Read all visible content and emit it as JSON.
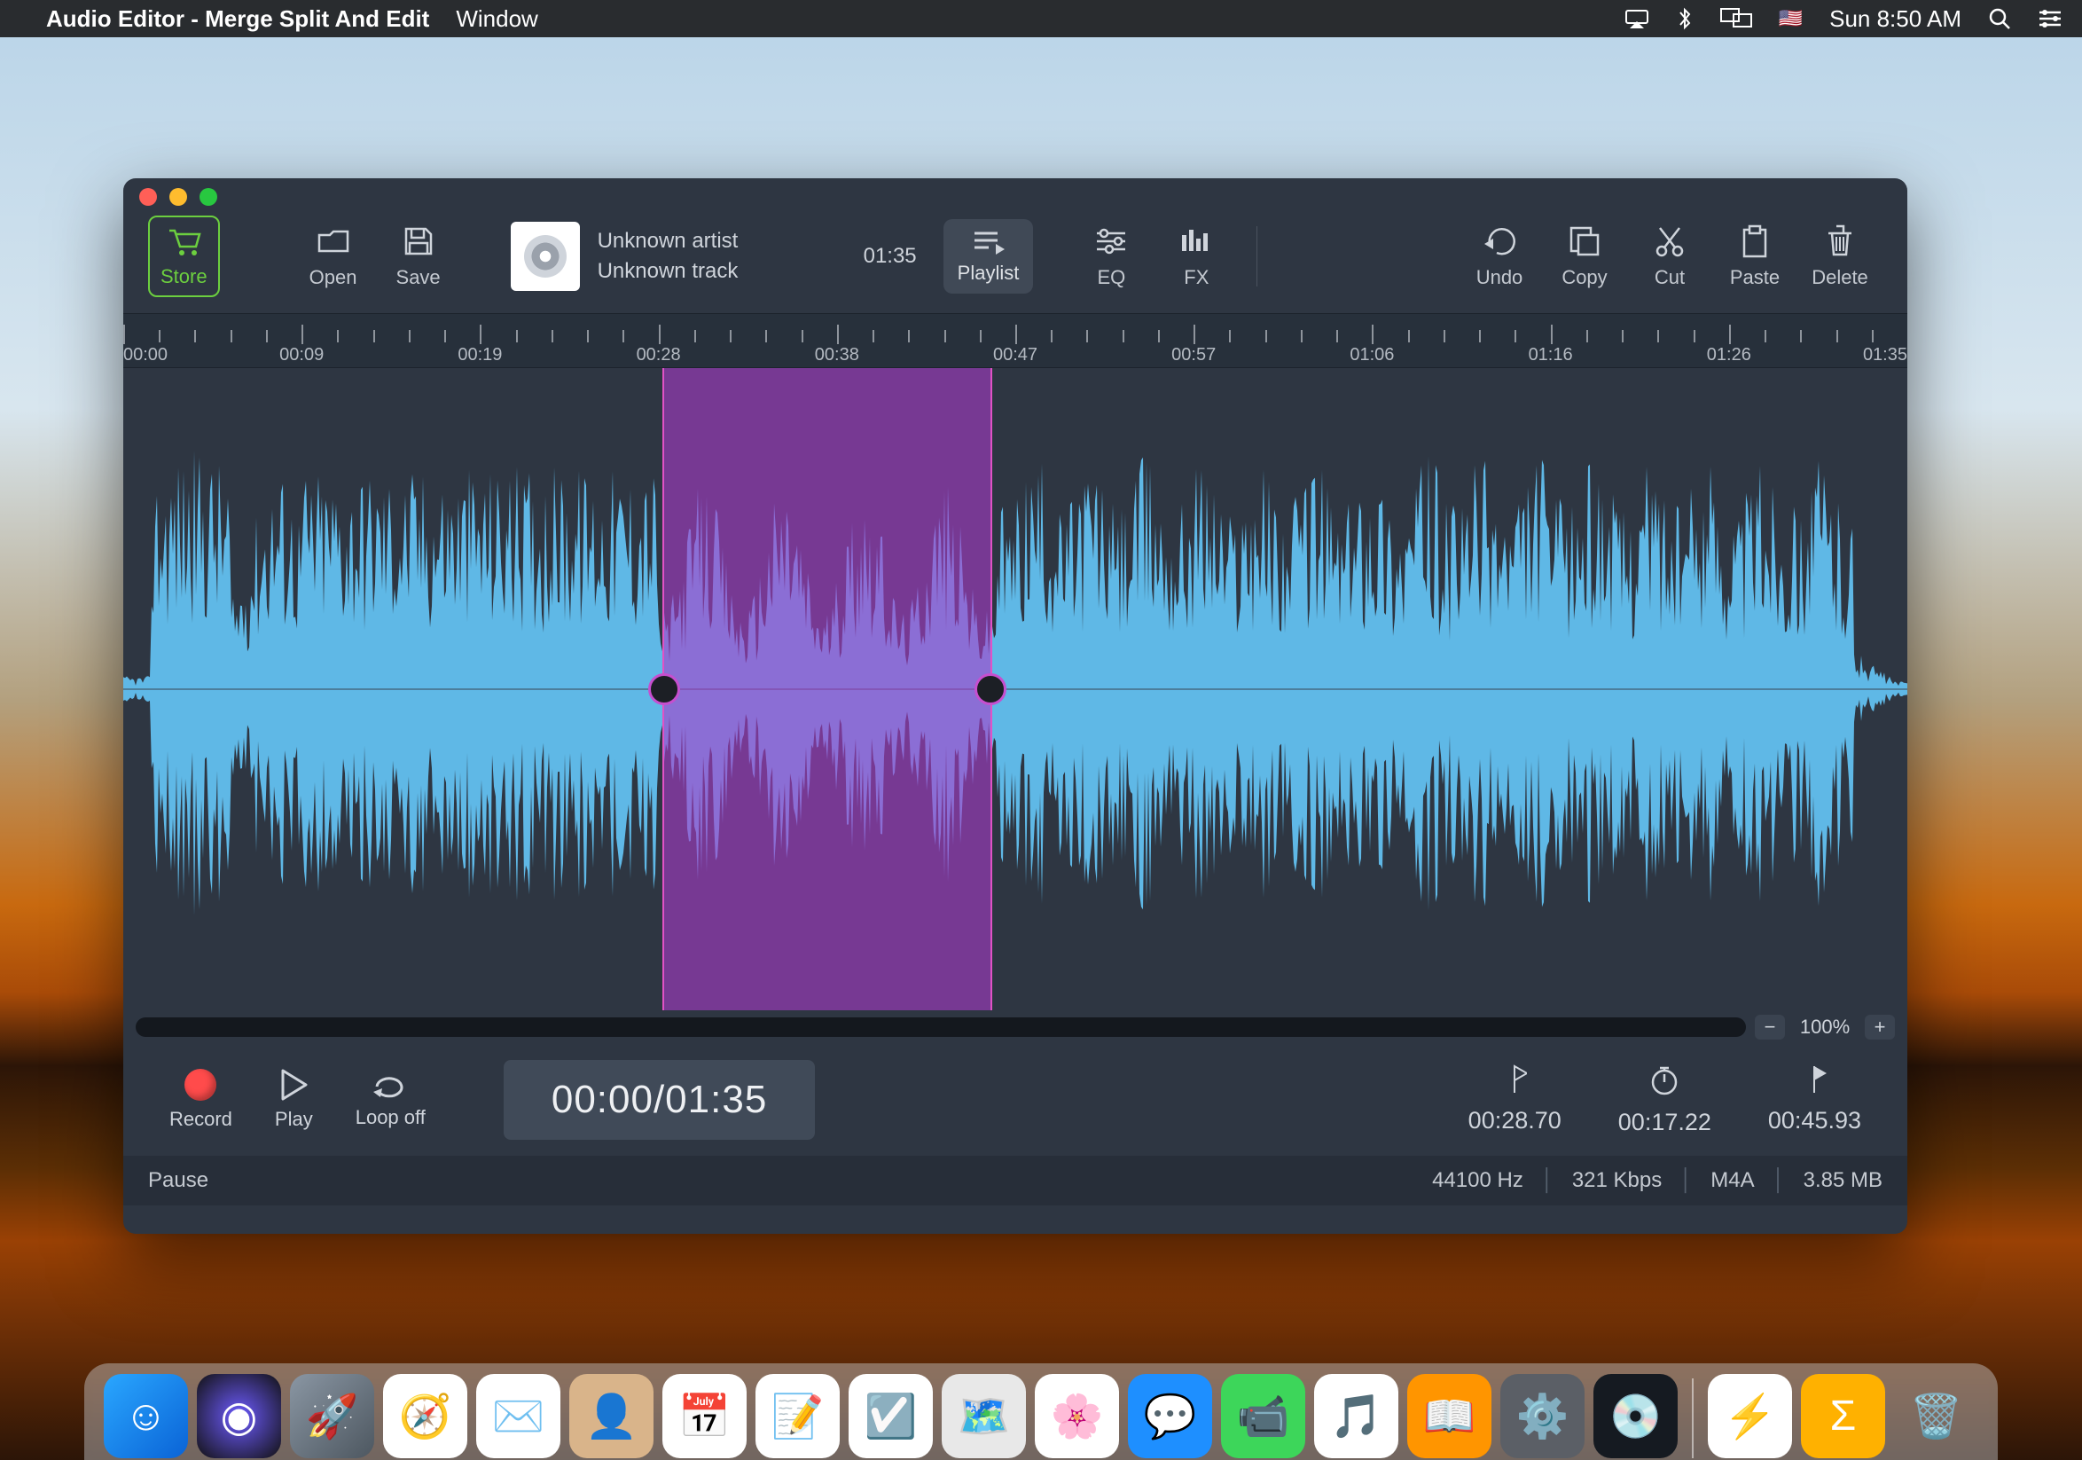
{
  "menubar": {
    "app_name": "Audio Editor - Merge Split And Edit",
    "menu_window": "Window",
    "clock": "Sun 8:50 AM"
  },
  "toolbar": {
    "store": "Store",
    "open": "Open",
    "save": "Save",
    "playlist": "Playlist",
    "eq": "EQ",
    "fx": "FX",
    "undo": "Undo",
    "copy": "Copy",
    "cut": "Cut",
    "paste": "Paste",
    "delete": "Delete"
  },
  "track": {
    "artist": "Unknown artist",
    "title": "Unknown track",
    "duration": "01:35"
  },
  "ruler": {
    "labels": [
      "00:00",
      "00:09",
      "00:19",
      "00:28",
      "00:38",
      "00:47",
      "00:57",
      "01:06",
      "01:16",
      "01:26",
      "01:35"
    ]
  },
  "selection": {
    "start_pct": 30.2,
    "end_pct": 48.5
  },
  "zoom": {
    "minus": "−",
    "plus": "+",
    "value": "100%"
  },
  "transport": {
    "record": "Record",
    "play": "Play",
    "loop": "Loop off",
    "timecode": "00:00/01:35",
    "in_time": "00:28.70",
    "dur_time": "00:17.22",
    "out_time": "00:45.93"
  },
  "status": {
    "left": "Pause",
    "sample_rate": "44100 Hz",
    "bitrate": "321 Kbps",
    "format": "M4A",
    "size": "3.85 MB"
  },
  "dock": {
    "items": [
      {
        "name": "finder",
        "bg": "linear-gradient(135deg,#2aa7ff,#0a63d6)",
        "glyph": "☺",
        "running": true
      },
      {
        "name": "siri",
        "bg": "radial-gradient(circle,#6d5bff,#111)",
        "glyph": "◉"
      },
      {
        "name": "launchpad",
        "bg": "linear-gradient(135deg,#8a96a3,#4d5760)",
        "glyph": "🚀"
      },
      {
        "name": "safari",
        "bg": "#fff",
        "glyph": "🧭"
      },
      {
        "name": "mail",
        "bg": "#fff",
        "glyph": "✉️"
      },
      {
        "name": "contacts",
        "bg": "#d9b48a",
        "glyph": "👤"
      },
      {
        "name": "calendar",
        "bg": "#fff",
        "glyph": "📅"
      },
      {
        "name": "notes",
        "bg": "#fff",
        "glyph": "📝"
      },
      {
        "name": "reminders",
        "bg": "#fff",
        "glyph": "☑️"
      },
      {
        "name": "maps",
        "bg": "#e8e8e8",
        "glyph": "🗺️"
      },
      {
        "name": "photos",
        "bg": "#fff",
        "glyph": "🌸"
      },
      {
        "name": "messages",
        "bg": "#1e8fff",
        "glyph": "💬"
      },
      {
        "name": "facetime",
        "bg": "#3dd65a",
        "glyph": "📹"
      },
      {
        "name": "itunes",
        "bg": "#fff",
        "glyph": "🎵"
      },
      {
        "name": "ibooks",
        "bg": "#ff9500",
        "glyph": "📖"
      },
      {
        "name": "appstore",
        "bg": "#5b5f66",
        "glyph": "⚙️"
      },
      {
        "name": "audio-editor",
        "bg": "#151a21",
        "glyph": "💿",
        "running": true
      }
    ],
    "right": [
      {
        "name": "thunderbolt",
        "bg": "#fff",
        "glyph": "⚡"
      },
      {
        "name": "summation",
        "bg": "#ffb100",
        "glyph": "Σ"
      },
      {
        "name": "trash",
        "bg": "transparent",
        "glyph": "🗑️"
      }
    ]
  }
}
